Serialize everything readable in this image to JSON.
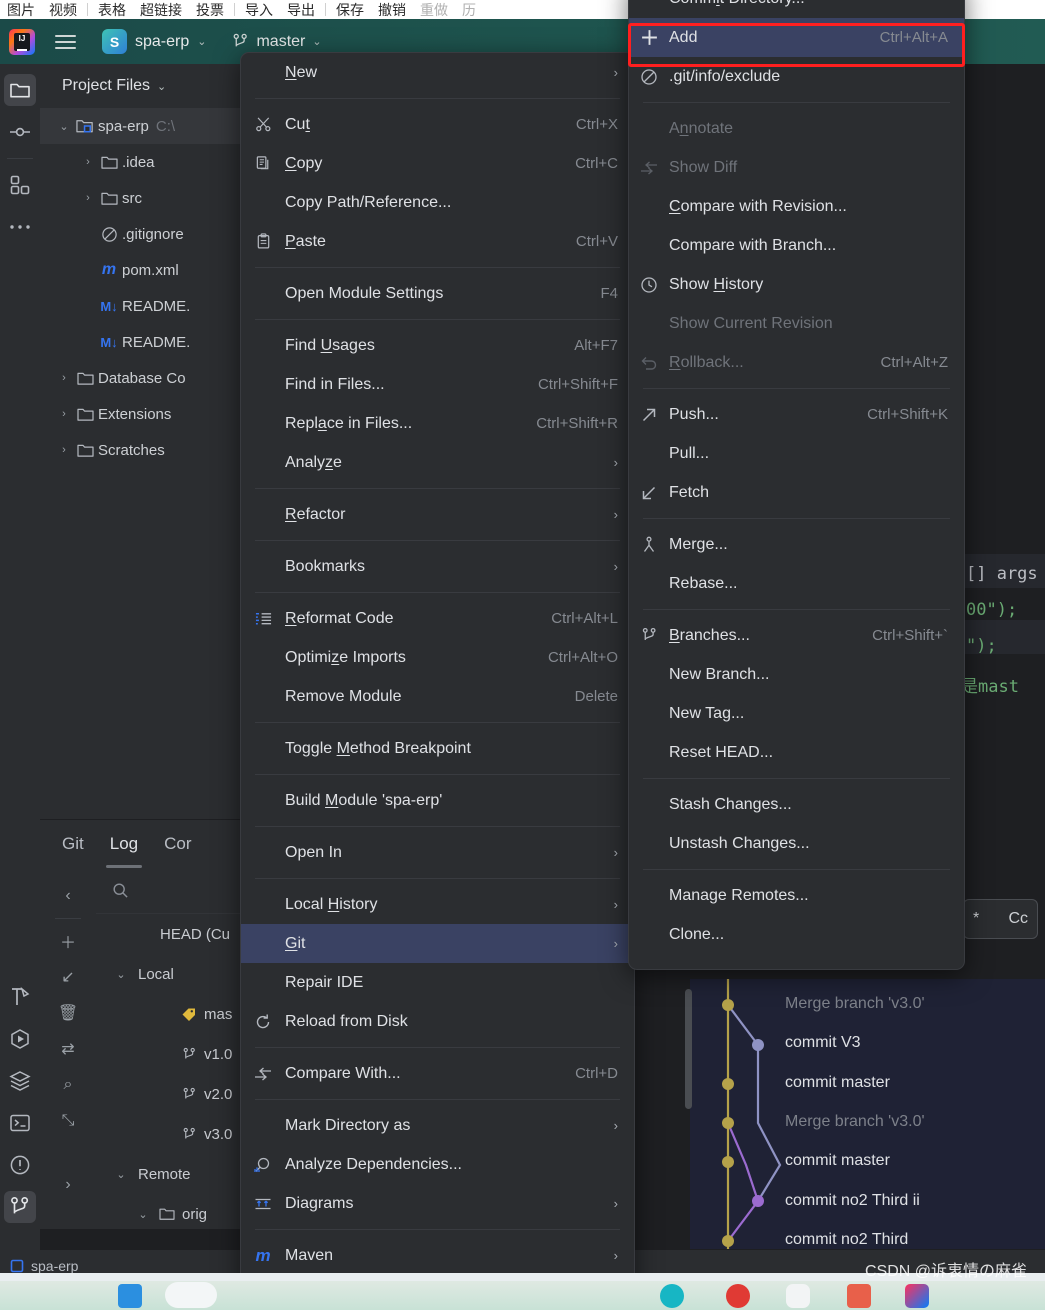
{
  "browser_toolbar": {
    "items": [
      "图片",
      "视频",
      "表格",
      "超链接",
      "投票",
      "导入",
      "导出",
      "保存",
      "撤销",
      "重做",
      "历"
    ]
  },
  "ide_header": {
    "app_icon": "intellij-idea-logo",
    "project_badge": "S",
    "project_name": "spa-erp",
    "branch_name": "master",
    "chevron": "⌄"
  },
  "rail": {
    "items": [
      {
        "name": "project-files-icon",
        "glyph": "folder",
        "selected": true
      },
      {
        "name": "commit-icon",
        "glyph": "commit",
        "selected": false
      },
      {
        "name": "structure-icon",
        "glyph": "structure",
        "selected": false
      },
      {
        "name": "more-tools-icon",
        "glyph": "dots",
        "selected": false
      }
    ],
    "bottom_items": [
      {
        "name": "build-icon",
        "glyph": "hammer"
      },
      {
        "name": "run-icon",
        "glyph": "run"
      },
      {
        "name": "services-icon",
        "glyph": "layers"
      },
      {
        "name": "terminal-icon",
        "glyph": "terminal"
      },
      {
        "name": "problems-icon",
        "glyph": "warning"
      },
      {
        "name": "git-icon",
        "glyph": "branch",
        "selected": true
      }
    ]
  },
  "project_panel": {
    "title": "Project Files",
    "tree": [
      {
        "indent": 0,
        "arrow": "⌄",
        "icon": "module",
        "label": "spa-erp",
        "path": "C:\\",
        "selected": true
      },
      {
        "indent": 1,
        "arrow": "›",
        "icon": "folder",
        "label": ".idea",
        "path": ""
      },
      {
        "indent": 1,
        "arrow": "›",
        "icon": "folder",
        "label": "src",
        "path": ""
      },
      {
        "indent": 1,
        "arrow": "",
        "icon": "gitignore",
        "label": ".gitignore",
        "path": ""
      },
      {
        "indent": 1,
        "arrow": "",
        "icon": "maven",
        "label": "pom.xml",
        "path": ""
      },
      {
        "indent": 1,
        "arrow": "",
        "icon": "markdown",
        "label": "README.",
        "path": ""
      },
      {
        "indent": 1,
        "arrow": "",
        "icon": "markdown",
        "label": "README.",
        "path": ""
      },
      {
        "indent": 0,
        "arrow": "›",
        "icon": "folder",
        "label": "Database Co",
        "path": ""
      },
      {
        "indent": 0,
        "arrow": "›",
        "icon": "folder",
        "label": "Extensions",
        "path": ""
      },
      {
        "indent": 0,
        "arrow": "›",
        "icon": "folder",
        "label": "Scratches",
        "path": ""
      }
    ]
  },
  "git_panel": {
    "tabs": [
      {
        "label": "Git",
        "active": false
      },
      {
        "label": "Log",
        "active": true
      },
      {
        "label": "Cor",
        "active": false
      }
    ],
    "search_placeholder": "",
    "toolbar_icons": [
      "collapse-left-icon",
      "add-icon",
      "pull-icon",
      "delete-icon",
      "diff-icon",
      "search-icon",
      "fetch-icon",
      "expand-right-icon"
    ],
    "branches": [
      {
        "indent": 1,
        "arrow": "",
        "icon": "",
        "label": "HEAD (Cu"
      },
      {
        "indent": 0,
        "arrow": "⌄",
        "icon": "",
        "label": "Local"
      },
      {
        "indent": 2,
        "arrow": "",
        "icon": "tag",
        "label": "mas"
      },
      {
        "indent": 2,
        "arrow": "",
        "icon": "branch",
        "label": "v1.0"
      },
      {
        "indent": 2,
        "arrow": "",
        "icon": "branch",
        "label": "v2.0"
      },
      {
        "indent": 2,
        "arrow": "",
        "icon": "branch",
        "label": "v3.0"
      },
      {
        "indent": 0,
        "arrow": "⌄",
        "icon": "",
        "label": "Remote"
      },
      {
        "indent": 1,
        "arrow": "⌄",
        "icon": "folder",
        "label": "orig"
      }
    ]
  },
  "editor": {
    "code_fragments": [
      {
        "text": "[] args",
        "color": "white"
      },
      {
        "text": "00\");",
        "color": "green"
      },
      {
        "text": "\");",
        "color": "green"
      },
      {
        "text": "是mast",
        "color": "green"
      }
    ],
    "cc_chip": {
      "star": "*",
      "label": "Cc"
    }
  },
  "commit_log": {
    "rows": [
      {
        "message": "Merge branch 'v3.0'",
        "dim": true
      },
      {
        "message": "commit V3",
        "dim": false
      },
      {
        "message": "commit master",
        "dim": false
      },
      {
        "message": "Merge branch 'v3.0'",
        "dim": true
      },
      {
        "message": "commit master",
        "dim": false
      },
      {
        "message": "commit no2 Third  ii",
        "dim": false
      },
      {
        "message": "commit no2 Third",
        "dim": false
      }
    ],
    "colors": {
      "master_lane": "#b5a24a",
      "v3_lane": "#8f93c4",
      "purple_lane": "#9b6bd0"
    }
  },
  "status_bar": {
    "module_icon": "module-icon",
    "module_label": "spa-erp"
  },
  "context_menu": {
    "items": [
      {
        "label": "New",
        "icon": "",
        "accel": "",
        "arrow": true,
        "mnemonic": "N"
      },
      {
        "sep": true
      },
      {
        "label": "Cut",
        "icon": "scissors-icon",
        "accel": "Ctrl+X",
        "mnemonic": "t"
      },
      {
        "label": "Copy",
        "icon": "copy-icon",
        "accel": "Ctrl+C",
        "mnemonic": "C"
      },
      {
        "label": "Copy Path/Reference...",
        "icon": "",
        "accel": ""
      },
      {
        "label": "Paste",
        "icon": "clipboard-icon",
        "accel": "Ctrl+V",
        "mnemonic": "P"
      },
      {
        "sep": true
      },
      {
        "label": "Open Module Settings",
        "icon": "",
        "accel": "F4"
      },
      {
        "sep": true
      },
      {
        "label": "Find Usages",
        "icon": "",
        "accel": "Alt+F7",
        "mnemonic": "U"
      },
      {
        "label": "Find in Files...",
        "icon": "",
        "accel": "Ctrl+Shift+F"
      },
      {
        "label": "Replace in Files...",
        "icon": "",
        "accel": "Ctrl+Shift+R",
        "mnemonic": "a"
      },
      {
        "label": "Analyze",
        "icon": "",
        "accel": "",
        "arrow": true,
        "mnemonic": "z"
      },
      {
        "sep": true
      },
      {
        "label": "Refactor",
        "icon": "",
        "accel": "",
        "arrow": true,
        "mnemonic": "R"
      },
      {
        "sep": true
      },
      {
        "label": "Bookmarks",
        "icon": "",
        "accel": "",
        "arrow": true
      },
      {
        "sep": true
      },
      {
        "label": "Reformat Code",
        "icon": "reformat-icon",
        "accel": "Ctrl+Alt+L",
        "mnemonic": "R"
      },
      {
        "label": "Optimize Imports",
        "icon": "",
        "accel": "Ctrl+Alt+O",
        "mnemonic": "z"
      },
      {
        "label": "Remove Module",
        "icon": "",
        "accel": "Delete"
      },
      {
        "sep": true
      },
      {
        "label": "Toggle Method Breakpoint",
        "icon": "",
        "accel": "",
        "mnemonic": "M"
      },
      {
        "sep": true
      },
      {
        "label": "Build Module 'spa-erp'",
        "icon": "",
        "accel": "",
        "mnemonic": "M"
      },
      {
        "sep": true
      },
      {
        "label": "Open In",
        "icon": "",
        "accel": "",
        "arrow": true
      },
      {
        "sep": true
      },
      {
        "label": "Local History",
        "icon": "",
        "accel": "",
        "arrow": true,
        "mnemonic": "H"
      },
      {
        "label": "Git",
        "icon": "",
        "accel": "",
        "arrow": true,
        "selected": true,
        "mnemonic": "G"
      },
      {
        "label": "Repair IDE",
        "icon": "",
        "accel": ""
      },
      {
        "label": "Reload from Disk",
        "icon": "reload-icon",
        "accel": ""
      },
      {
        "sep": true
      },
      {
        "label": "Compare With...",
        "icon": "diff-icon",
        "accel": "Ctrl+D"
      },
      {
        "sep": true
      },
      {
        "label": "Mark Directory as",
        "icon": "",
        "accel": "",
        "arrow": true
      },
      {
        "label": "Analyze Dependencies...",
        "icon": "dependencies-icon",
        "accel": ""
      },
      {
        "label": "Diagrams",
        "icon": "diagram-icon",
        "accel": "",
        "arrow": true
      },
      {
        "sep": true
      },
      {
        "label": "Maven",
        "icon": "maven-icon",
        "accel": "",
        "arrow": true
      },
      {
        "sep": true
      }
    ]
  },
  "git_submenu": {
    "items": [
      {
        "label": "Commit Directory...",
        "icon": "",
        "accel": "",
        "mnemonic": "i"
      },
      {
        "label": "Add",
        "icon": "plus-icon",
        "accel": "Ctrl+Alt+A",
        "selected": true,
        "highlighted": true
      },
      {
        "label": ".git/info/exclude",
        "icon": "exclude-icon",
        "accel": ""
      },
      {
        "sep": true
      },
      {
        "label": "Annotate",
        "icon": "",
        "accel": "",
        "disabled": true,
        "mnemonic": "n"
      },
      {
        "label": "Show Diff",
        "icon": "diff-icon",
        "accel": "",
        "disabled": true
      },
      {
        "label": "Compare with Revision...",
        "icon": "",
        "accel": "",
        "mnemonic": "C"
      },
      {
        "label": "Compare with Branch...",
        "icon": "",
        "accel": ""
      },
      {
        "label": "Show History",
        "icon": "clock-icon",
        "accel": "",
        "mnemonic": "H"
      },
      {
        "label": "Show Current Revision",
        "icon": "",
        "accel": "",
        "disabled": true
      },
      {
        "label": "Rollback...",
        "icon": "rollback-icon",
        "accel": "Ctrl+Alt+Z",
        "disabled": true,
        "mnemonic": "R"
      },
      {
        "sep": true
      },
      {
        "label": "Push...",
        "icon": "push-icon",
        "accel": "Ctrl+Shift+K"
      },
      {
        "label": "Pull...",
        "icon": "",
        "accel": ""
      },
      {
        "label": "Fetch",
        "icon": "fetch-icon",
        "accel": ""
      },
      {
        "sep": true
      },
      {
        "label": "Merge...",
        "icon": "merge-icon",
        "accel": ""
      },
      {
        "label": "Rebase...",
        "icon": "",
        "accel": ""
      },
      {
        "sep": true
      },
      {
        "label": "Branches...",
        "icon": "branch-icon",
        "accel": "Ctrl+Shift+`",
        "mnemonic": "B"
      },
      {
        "label": "New Branch...",
        "icon": "",
        "accel": ""
      },
      {
        "label": "New Tag...",
        "icon": "",
        "accel": ""
      },
      {
        "label": "Reset HEAD...",
        "icon": "",
        "accel": ""
      },
      {
        "sep": true
      },
      {
        "label": "Stash Changes...",
        "icon": "",
        "accel": ""
      },
      {
        "label": "Unstash Changes...",
        "icon": "",
        "accel": ""
      },
      {
        "sep": true
      },
      {
        "label": "Manage Remotes...",
        "icon": "",
        "accel": ""
      },
      {
        "label": "Clone...",
        "icon": "",
        "accel": ""
      }
    ]
  },
  "watermark": "CSDN @诉衷情の麻雀",
  "colors": {
    "menu_bg": "#2b2d30",
    "menu_selected": "#3a4263",
    "highlight_border": "#ff1f1f",
    "header_teal": "#1d514c",
    "accent_blue": "#3574f0"
  }
}
